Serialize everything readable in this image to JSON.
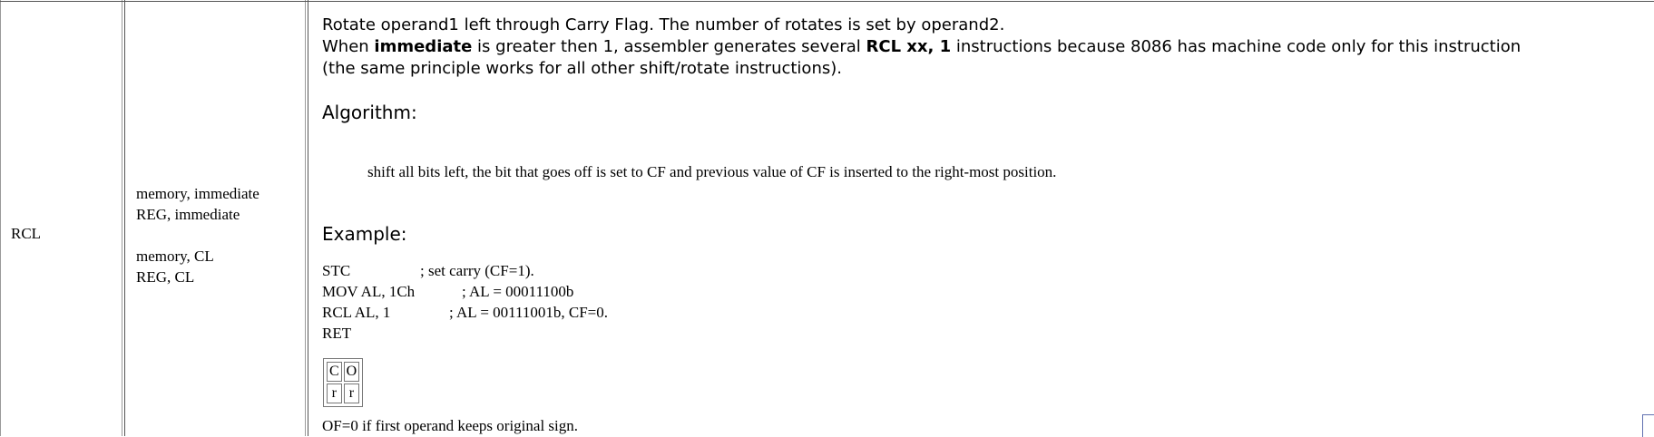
{
  "row": {
    "mnemonic": "RCL",
    "operands": [
      "memory, immediate",
      "REG, immediate",
      "memory, CL",
      "REG, CL"
    ],
    "description": {
      "line1": "Rotate operand1 left through Carry Flag. The number of rotates is set by operand2.",
      "line2_pre": "When ",
      "line2_b1": "immediate",
      "line2_mid": " is greater then 1, assembler generates several ",
      "line2_b2": "RCL xx, 1",
      "line2_post": " instructions because 8086 has machine code only for this instruction",
      "line3": "(the same principle works for all other shift/rotate instructions)."
    },
    "algorithm_heading": "Algorithm:",
    "algorithm_text": "shift all bits left, the bit that goes off is set to CF and previous value of CF is inserted to the right-most position.",
    "example_heading": "Example:",
    "example_lines": [
      {
        "instr": "STC",
        "comment": "; set carry (CF=1)."
      },
      {
        "instr": "MOV AL, 1Ch",
        "comment": "; AL = 00011100b"
      },
      {
        "instr": "RCL AL, 1",
        "comment": "; AL = 00111001b,  CF=0."
      },
      {
        "instr": "RET",
        "comment": ""
      }
    ],
    "flags": {
      "header": [
        "C",
        "O"
      ],
      "values": [
        "r",
        "r"
      ]
    },
    "note": "OF=0 if first operand keeps original sign."
  }
}
